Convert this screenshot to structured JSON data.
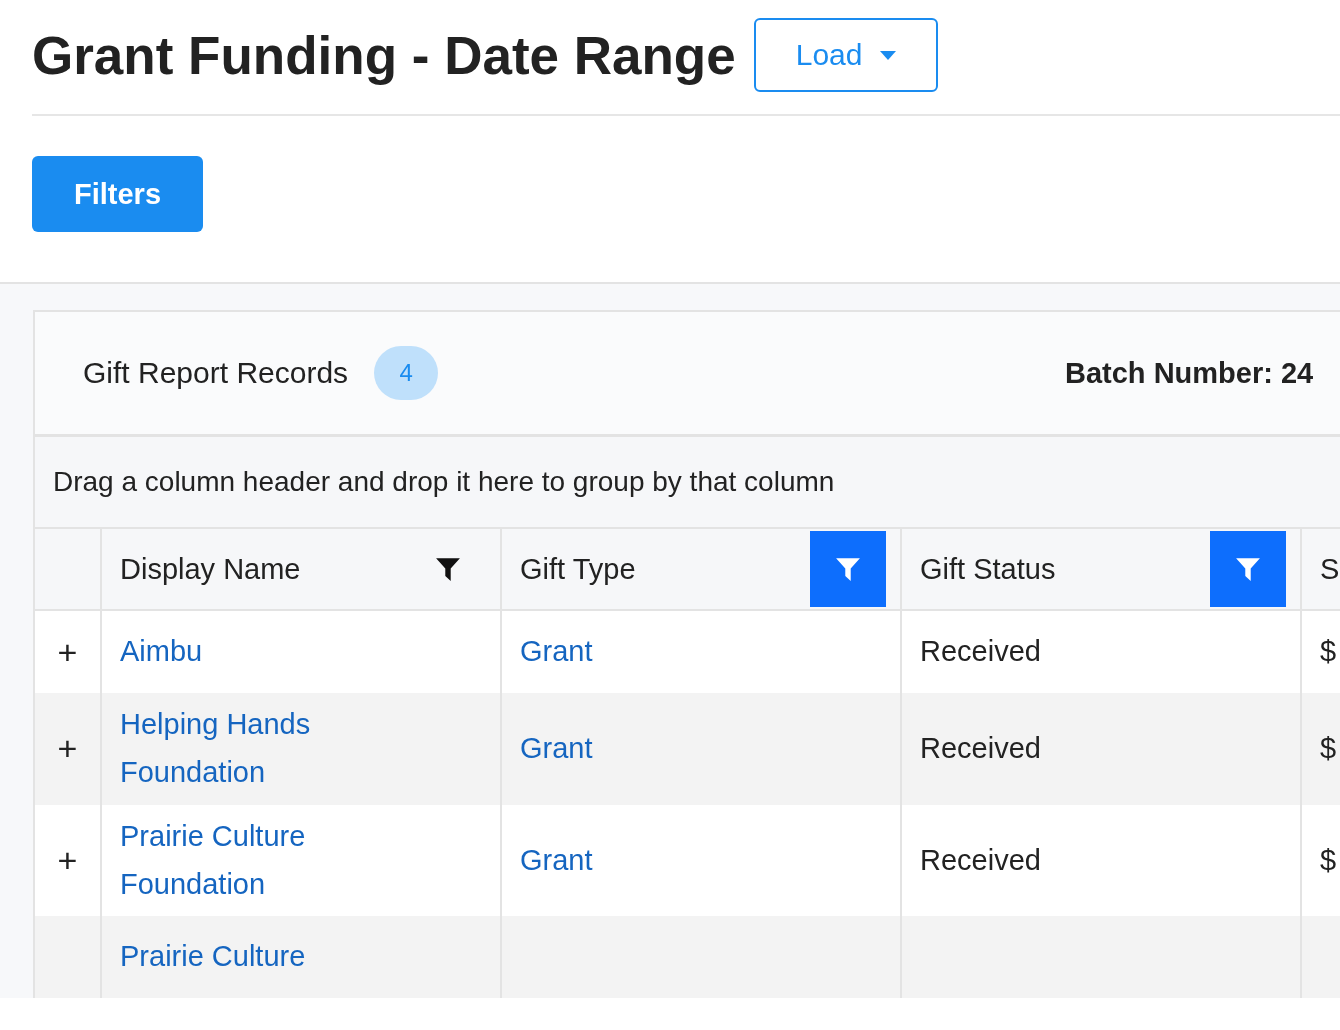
{
  "page": {
    "title": "Grant Funding - Date Range",
    "load_button": "Load"
  },
  "filters_button": "Filters",
  "card": {
    "title": "Gift Report Records",
    "count": "4",
    "batch_label": "Batch Number: 24"
  },
  "group_panel": "Drag a column header and drop it here to group by that column",
  "table": {
    "columns": [
      {
        "label": "Display Name",
        "filtered": false
      },
      {
        "label": "Gift Type",
        "filtered": true
      },
      {
        "label": "Gift Status",
        "filtered": true
      },
      {
        "label": "S"
      }
    ],
    "rows": [
      {
        "expand": "+",
        "display_name": "Aimbu",
        "gift_type": "Grant",
        "gift_status": "Received",
        "column_4": "$"
      },
      {
        "expand": "+",
        "display_name": "Helping Hands Foundation",
        "gift_type": "Grant",
        "gift_status": "Received",
        "column_4": "$"
      },
      {
        "expand": "+",
        "display_name": "Prairie Culture Foundation",
        "gift_type": "Grant",
        "gift_status": "Received",
        "column_4": "$"
      },
      {
        "display_name": "Prairie Culture"
      }
    ]
  }
}
